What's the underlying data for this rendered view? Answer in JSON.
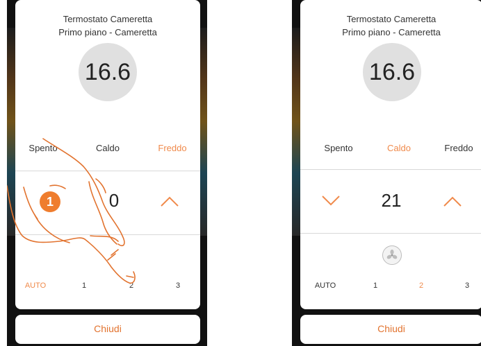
{
  "colors": {
    "accent": "#f08a4b",
    "close_text": "#e2732f",
    "badge": "#ef7d2e"
  },
  "left_screen": {
    "title_line1": "Termostato Cameretta",
    "title_line2": "Primo piano - Cameretta",
    "temperature": "16.6",
    "modes": {
      "off": "Spento",
      "heat": "Caldo",
      "cool": "Freddo",
      "selected": "Freddo"
    },
    "setpoint": "0",
    "speeds": {
      "auto": "AUTO",
      "s1": "1",
      "s2": "2",
      "s3": "3",
      "selected": "AUTO"
    },
    "close_label": "Chiudi",
    "step_badge": "1"
  },
  "right_screen": {
    "title_line1": "Termostato Cameretta",
    "title_line2": "Primo piano - Cameretta",
    "temperature": "16.6",
    "modes": {
      "off": "Spento",
      "heat": "Caldo",
      "cool": "Freddo",
      "selected": "Caldo"
    },
    "setpoint": "21",
    "speeds": {
      "auto": "AUTO",
      "s1": "1",
      "s2": "2",
      "s3": "3",
      "selected": "2"
    },
    "close_label": "Chiudi",
    "icons": {
      "decrease": "chevron-down-icon",
      "increase": "chevron-up-icon",
      "fan": "fan-icon"
    }
  }
}
